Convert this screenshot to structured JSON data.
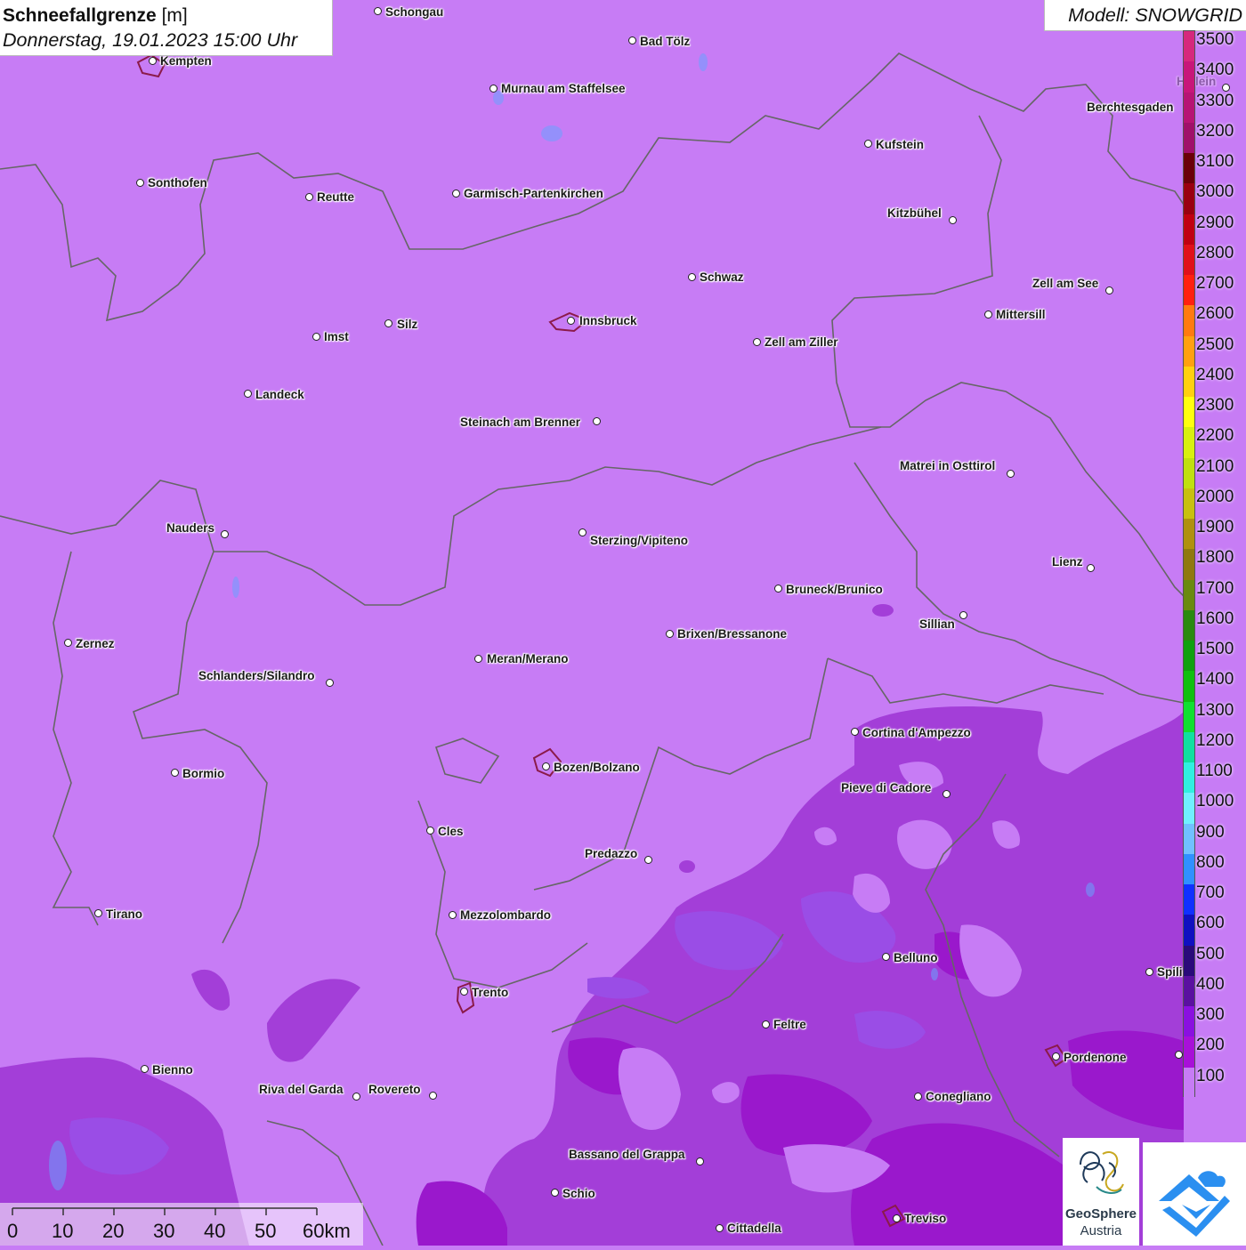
{
  "title": {
    "bold": "Schneefallgrenze",
    "unit": "[m]",
    "datetime": "Donnerstag, 19.01.2023 15:00 Uhr"
  },
  "model": "Modell: SNOWGRID",
  "legend": {
    "labels": [
      "3500",
      "3400",
      "3300",
      "3200",
      "3100",
      "3000",
      "2900",
      "2800",
      "2700",
      "2600",
      "2500",
      "2400",
      "2300",
      "2200",
      "2100",
      "2000",
      "1900",
      "1800",
      "1700",
      "1600",
      "1500",
      "1400",
      "1300",
      "1200",
      "1100",
      "1000",
      "900",
      "800",
      "700",
      "600",
      "500",
      "400",
      "300",
      "200",
      "100"
    ],
    "colors": [
      "#d6287d",
      "#c8167a",
      "#b71474",
      "#a0106a",
      "#6b0008",
      "#9a0010",
      "#c00012",
      "#e0101a",
      "#ff2010",
      "#ff7a10",
      "#ffa010",
      "#ffd010",
      "#ffff10",
      "#d8f010",
      "#c0e010",
      "#c8c010",
      "#b09010",
      "#907810",
      "#6a8a10",
      "#2a8a10",
      "#10a010",
      "#10c010",
      "#10e030",
      "#10e0a0",
      "#30f0e0",
      "#70f0ff",
      "#70c0ff",
      "#3090ff",
      "#1030ff",
      "#1010c0",
      "#2a0a7a",
      "#5a10a0",
      "#8a10e0",
      "#a810d8",
      "#c77cf5"
    ]
  },
  "cities": [
    {
      "name": "Schongau"
    },
    {
      "name": "Bad Tölz"
    },
    {
      "name": "Kempten"
    },
    {
      "name": "Murnau am Staffelsee"
    },
    {
      "name": "Berchtesgaden"
    },
    {
      "name": "Kufstein"
    },
    {
      "name": "Sonthofen"
    },
    {
      "name": "Reutte"
    },
    {
      "name": "Garmisch-Partenkirchen"
    },
    {
      "name": "Kitzbühel"
    },
    {
      "name": "Schwaz"
    },
    {
      "name": "Zell am See"
    },
    {
      "name": "Innsbruck"
    },
    {
      "name": "Mittersill"
    },
    {
      "name": "Imst"
    },
    {
      "name": "Silz"
    },
    {
      "name": "Zell am Ziller"
    },
    {
      "name": "Landeck"
    },
    {
      "name": "Steinach am Brenner"
    },
    {
      "name": "Matrei in Osttirol"
    },
    {
      "name": "Nauders"
    },
    {
      "name": "Sterzing/Vipiteno"
    },
    {
      "name": "Lienz"
    },
    {
      "name": "Bruneck/Brunico"
    },
    {
      "name": "Sillian"
    },
    {
      "name": "Zernez"
    },
    {
      "name": "Brixen/Bressanone"
    },
    {
      "name": "Meran/Merano"
    },
    {
      "name": "Schlanders/Silandro"
    },
    {
      "name": "Cortina d'Ampezzo"
    },
    {
      "name": "Bormio"
    },
    {
      "name": "Bozen/Bolzano"
    },
    {
      "name": "Pieve di Cadore"
    },
    {
      "name": "Cles"
    },
    {
      "name": "Predazzo"
    },
    {
      "name": "Tirano"
    },
    {
      "name": "Mezzolombardo"
    },
    {
      "name": "Belluno"
    },
    {
      "name": "Spili"
    },
    {
      "name": "Trento"
    },
    {
      "name": "Feltre"
    },
    {
      "name": "Pordenone"
    },
    {
      "name": "Bienno"
    },
    {
      "name": "Riva del Garda"
    },
    {
      "name": "Rovereto"
    },
    {
      "name": "Conegliano"
    },
    {
      "name": "Bassano del Grappa"
    },
    {
      "name": "Schio"
    },
    {
      "name": "Treviso"
    },
    {
      "name": "Cittadella"
    },
    {
      "name": "Hallein"
    }
  ],
  "scale": {
    "labels": [
      "0",
      "10",
      "20",
      "30",
      "40",
      "50",
      "60km"
    ]
  },
  "logo": {
    "line1": "GeoSphere",
    "line2": "Austria"
  }
}
